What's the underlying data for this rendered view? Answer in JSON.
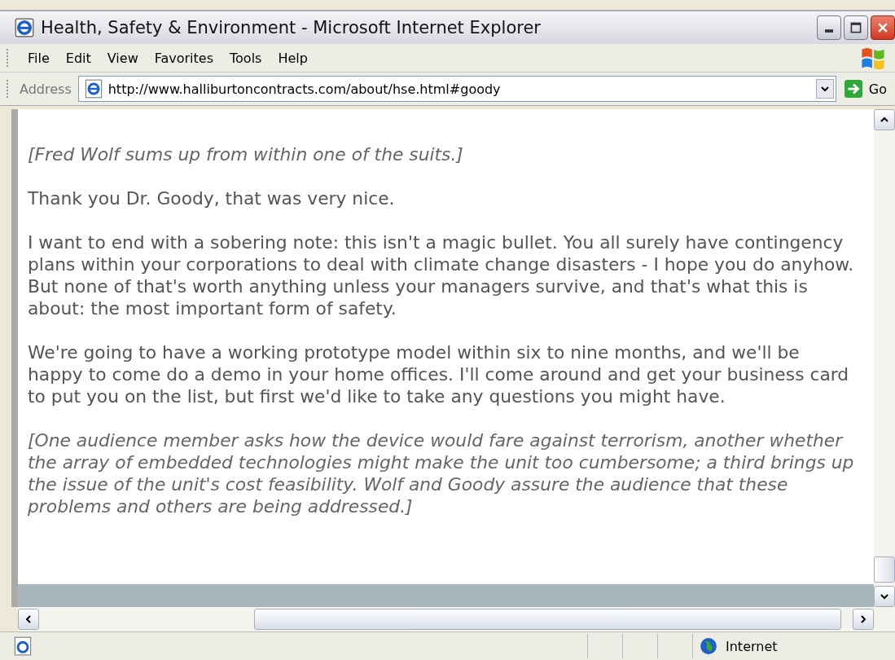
{
  "window": {
    "title": "Health, Safety & Environment - Microsoft Internet Explorer"
  },
  "menu": [
    "File",
    "Edit",
    "View",
    "Favorites",
    "Tools",
    "Help"
  ],
  "address_bar": {
    "label": "Address",
    "url": "http://www.halliburtoncontracts.com/about/hse.html#goody",
    "go": "Go"
  },
  "content": [
    {
      "kind": "stage",
      "text": "[Fred Wolf sums up from within one of the suits.]"
    },
    {
      "kind": "speech",
      "text": "Thank you Dr. Goody, that was very nice."
    },
    {
      "kind": "speech",
      "text": "I want to end with a sobering note: this isn't a magic bullet. You all surely have contingency plans within your corporations to deal with climate change disasters - I hope you do anyhow. But none of that's worth anything unless your managers survive, and that's what this is about: the most important form of safety."
    },
    {
      "kind": "speech",
      "text": "We're going to have a working prototype model within six to nine months, and we'll be happy to come do a demo in your home offices. I'll come around and get your business card to put you on the list, but first we'd like to take any questions you might have."
    },
    {
      "kind": "stage",
      "text": "[One audience member asks how the device would fare against terrorism, another whether the array of embedded technologies might make the unit too cumbersome; a third brings up the issue of the unit's cost feasibility. Wolf and Goody assure the audience that these problems and others are being addressed.]"
    }
  ],
  "status_bar": {
    "zone": "Internet"
  }
}
